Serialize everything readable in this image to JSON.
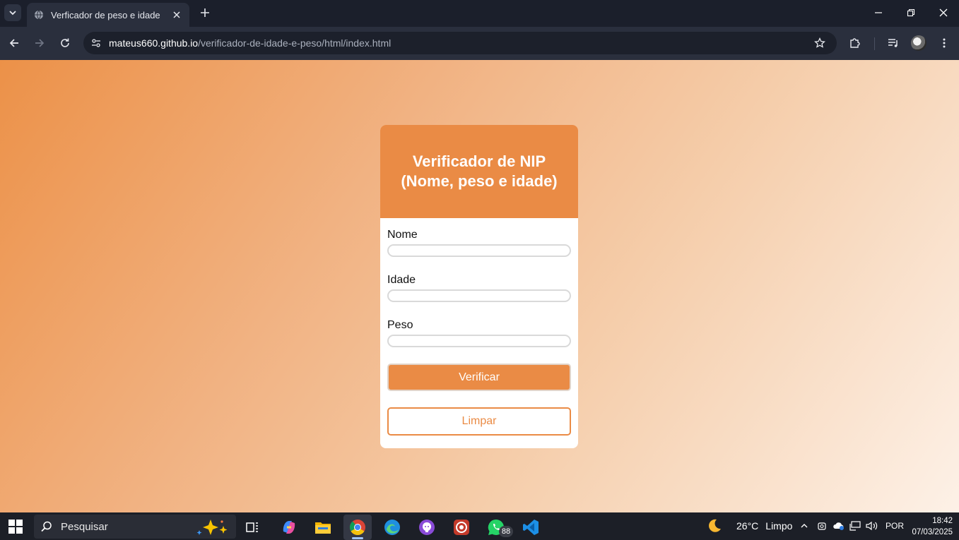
{
  "browser": {
    "tab": {
      "title": "Verficador de peso e idade"
    },
    "address": {
      "host": "mateus660.github.io",
      "path": "/verificador-de-idade-e-peso/html/index.html"
    }
  },
  "page": {
    "card": {
      "title": "Verificador de NIP (Nome, peso e idade)",
      "fields": [
        {
          "label": "Nome",
          "value": ""
        },
        {
          "label": "Idade",
          "value": ""
        },
        {
          "label": "Peso",
          "value": ""
        }
      ],
      "verify_label": "Verificar",
      "clear_label": "Limpar"
    },
    "colors": {
      "accent": "#ea8b45",
      "gradient_start": "#ec9148",
      "gradient_end": "#fdf1e7"
    }
  },
  "taskbar": {
    "search_placeholder": "Pesquisar",
    "whatsapp_badge": "88",
    "weather": {
      "temperature": "26°C",
      "condition": "Limpo"
    },
    "language": "POR",
    "time": "18:42",
    "date": "07/03/2025"
  }
}
